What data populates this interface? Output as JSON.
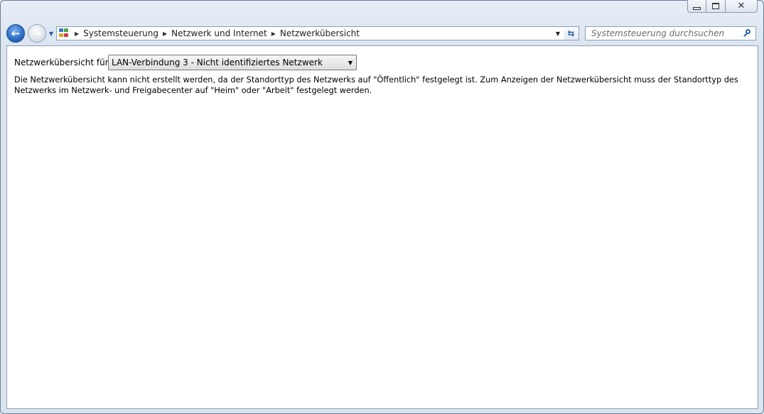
{
  "window": {
    "caption": {
      "minimize": "minimize-icon",
      "maximize": "restore-icon",
      "close": "✕"
    }
  },
  "navigation": {
    "back_icon": "back-arrow-icon",
    "forward_icon": "forward-arrow-icon",
    "breadcrumbs": [
      "Systemsteuerung",
      "Netzwerk und Internet",
      "Netzwerkübersicht"
    ],
    "search_placeholder": "Systemsteuerung durchsuchen"
  },
  "content": {
    "label": "Netzwerkübersicht für",
    "selected_network": "LAN-Verbindung 3 - Nicht identifiziertes Netzwerk",
    "message": "Die Netzwerkübersicht kann nicht erstellt werden, da der Standorttyp des Netzwerks auf \"Öffentlich\" festgelegt ist. Zum Anzeigen der Netzwerkübersicht muss der Standorttyp des Netzwerks im Netzwerk- und Freigabecenter auf \"Heim\" oder \"Arbeit\" festgelegt werden."
  },
  "colors": {
    "accent": "#2f6fc6",
    "content_bg": "#ffffff",
    "frame": "#dbe5f0"
  }
}
